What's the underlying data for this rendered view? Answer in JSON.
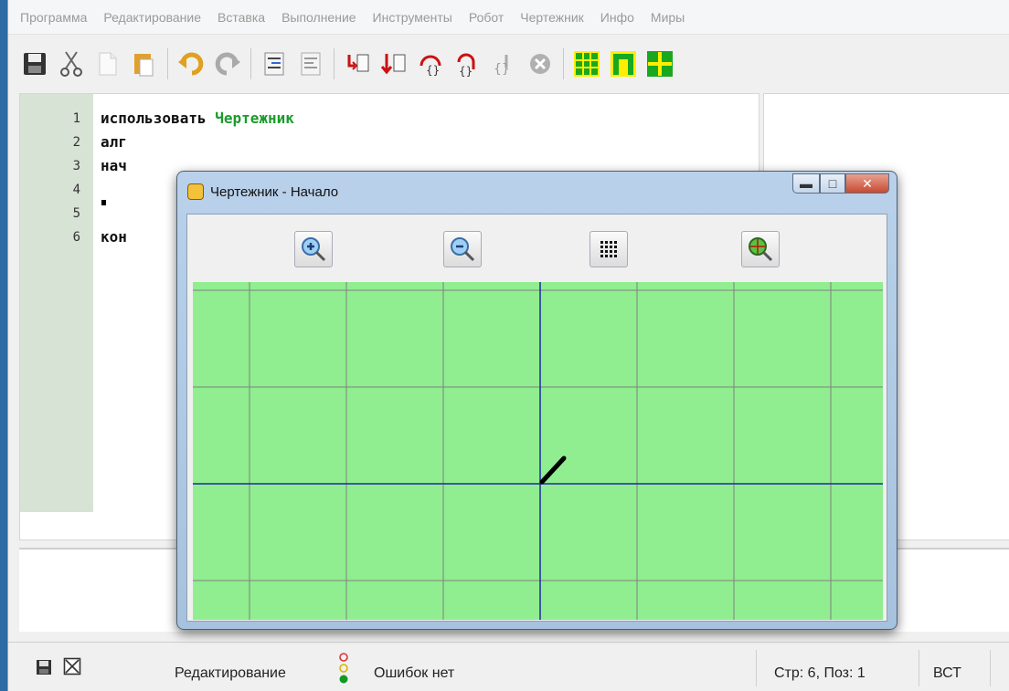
{
  "menu": [
    "Программа",
    "Редактирование",
    "Вставка",
    "Выполнение",
    "Инструменты",
    "Робот",
    "Чертежник",
    "Инфо",
    "Миры"
  ],
  "toolbar": {
    "icons": [
      "save-icon",
      "cut-icon",
      "copy-icon",
      "paste-icon",
      "undo-icon",
      "redo-icon",
      "indent-icon",
      "unindent-icon",
      "run-icon",
      "step-icon",
      "step-into-icon",
      "step-out-icon",
      "step-over-icon",
      "stop-icon",
      "robot-grid-icon",
      "robot-wall-icon",
      "drafter-grid-icon"
    ]
  },
  "editor": {
    "lines": [
      {
        "num": "1",
        "keyword": "использовать",
        "name": "Чертежник"
      },
      {
        "num": "2",
        "keyword": "алг",
        "name": ""
      },
      {
        "num": "3",
        "keyword": "нач",
        "name": ""
      },
      {
        "num": "4",
        "keyword": "",
        "name": ""
      },
      {
        "num": "5",
        "keyword": "кон",
        "name": ""
      },
      {
        "num": "6",
        "keyword": "",
        "name": ""
      }
    ]
  },
  "drafter_window": {
    "title": "Чертежник - Начало",
    "buttons": [
      "zoom-in-icon",
      "zoom-out-icon",
      "grid-icon",
      "zoom-fit-icon"
    ],
    "colors": {
      "canvas_bg": "#90ee90",
      "grid_line": "#808080",
      "axis_line": "#1f2aa0",
      "pen": "#000000"
    }
  },
  "status": {
    "mode": "Редактирование",
    "errors": "Ошибок нет",
    "position": "Стр: 6, Поз: 1",
    "insert_mode": "ВСТ"
  }
}
